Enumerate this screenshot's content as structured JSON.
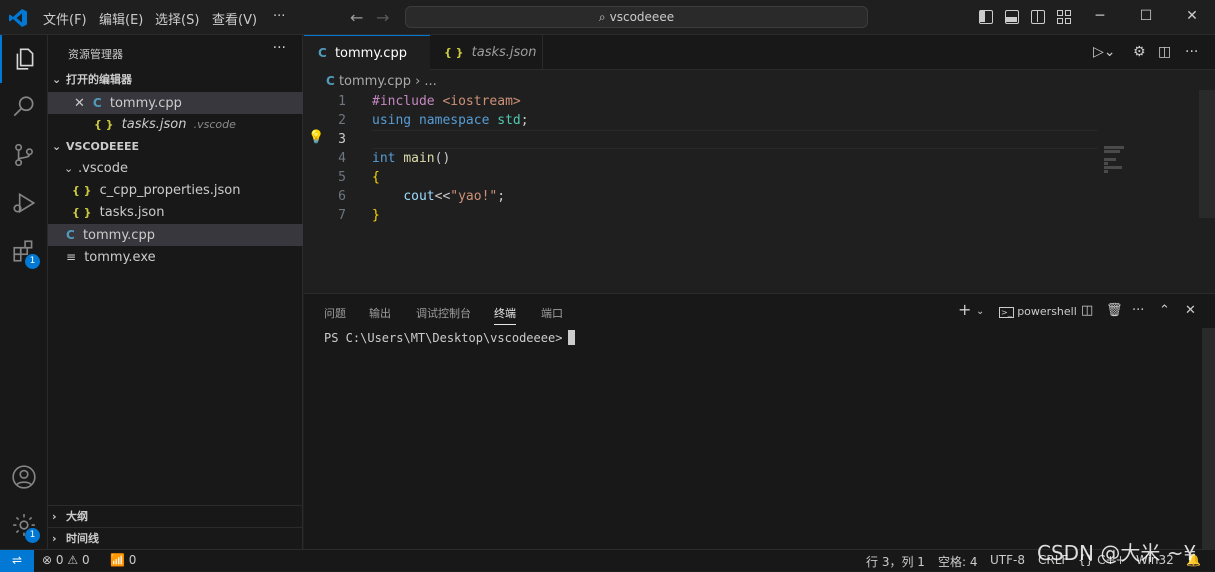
{
  "titlebar": {
    "menus": [
      "文件(F)",
      "编辑(E)",
      "选择(S)",
      "查看(V)",
      "···"
    ],
    "search_text": "vscodeeee"
  },
  "activity": {
    "extensions_badge": "1",
    "manage_badge": "1"
  },
  "sidebar": {
    "title": "资源管理器",
    "more": "···",
    "open_editors_label": "打开的编辑器",
    "open_editors": [
      {
        "close": "✕",
        "icon": "C",
        "label": "tommy.cpp"
      },
      {
        "icon": "{ }",
        "label": "tasks.json",
        "hint": ".vscode"
      }
    ],
    "folder_label": "VSCODEEEE",
    "tree": [
      {
        "label": ".vscode"
      },
      {
        "icon": "{ }",
        "label": "c_cpp_properties.json"
      },
      {
        "icon": "{ }",
        "label": "tasks.json"
      },
      {
        "icon": "C",
        "label": "tommy.cpp"
      },
      {
        "icon": "≡",
        "label": "tommy.exe"
      }
    ],
    "outline_label": "大纲",
    "timeline_label": "时间线"
  },
  "editor": {
    "tabs": [
      {
        "icon": "C",
        "label": "tommy.cpp"
      },
      {
        "icon": "{ }",
        "label": "tasks.json"
      }
    ],
    "breadcrumb": "tommy.cpp  ›  ...",
    "line_numbers": [
      "1",
      "2",
      "3",
      "4",
      "5",
      "6",
      "7"
    ],
    "lines": [
      "#include <iostream>",
      "using namespace std;",
      "",
      "int main()",
      "{",
      "    cout<<\"yao!\";",
      "}"
    ]
  },
  "panel": {
    "tabs": [
      "问题",
      "输出",
      "调试控制台",
      "终端",
      "端口"
    ],
    "shell": "powershell",
    "prompt": "PS C:\\Users\\MT\\Desktop\\vscodeeee>"
  },
  "status": {
    "errors": "0",
    "warnings": "0",
    "ports": "0",
    "position": "行 3，列 1",
    "spaces": "空格: 4",
    "encoding": "UTF-8",
    "eol": "CRLF",
    "language": "C++",
    "platform": "Win32"
  },
  "watermark": "CSDN @大米 ~¥",
  "colors": {
    "accent": "#0078d4",
    "keyword_purple": "#c586c0",
    "keyword_blue": "#569cd6",
    "string": "#ce9178",
    "type": "#4ec9b0"
  }
}
